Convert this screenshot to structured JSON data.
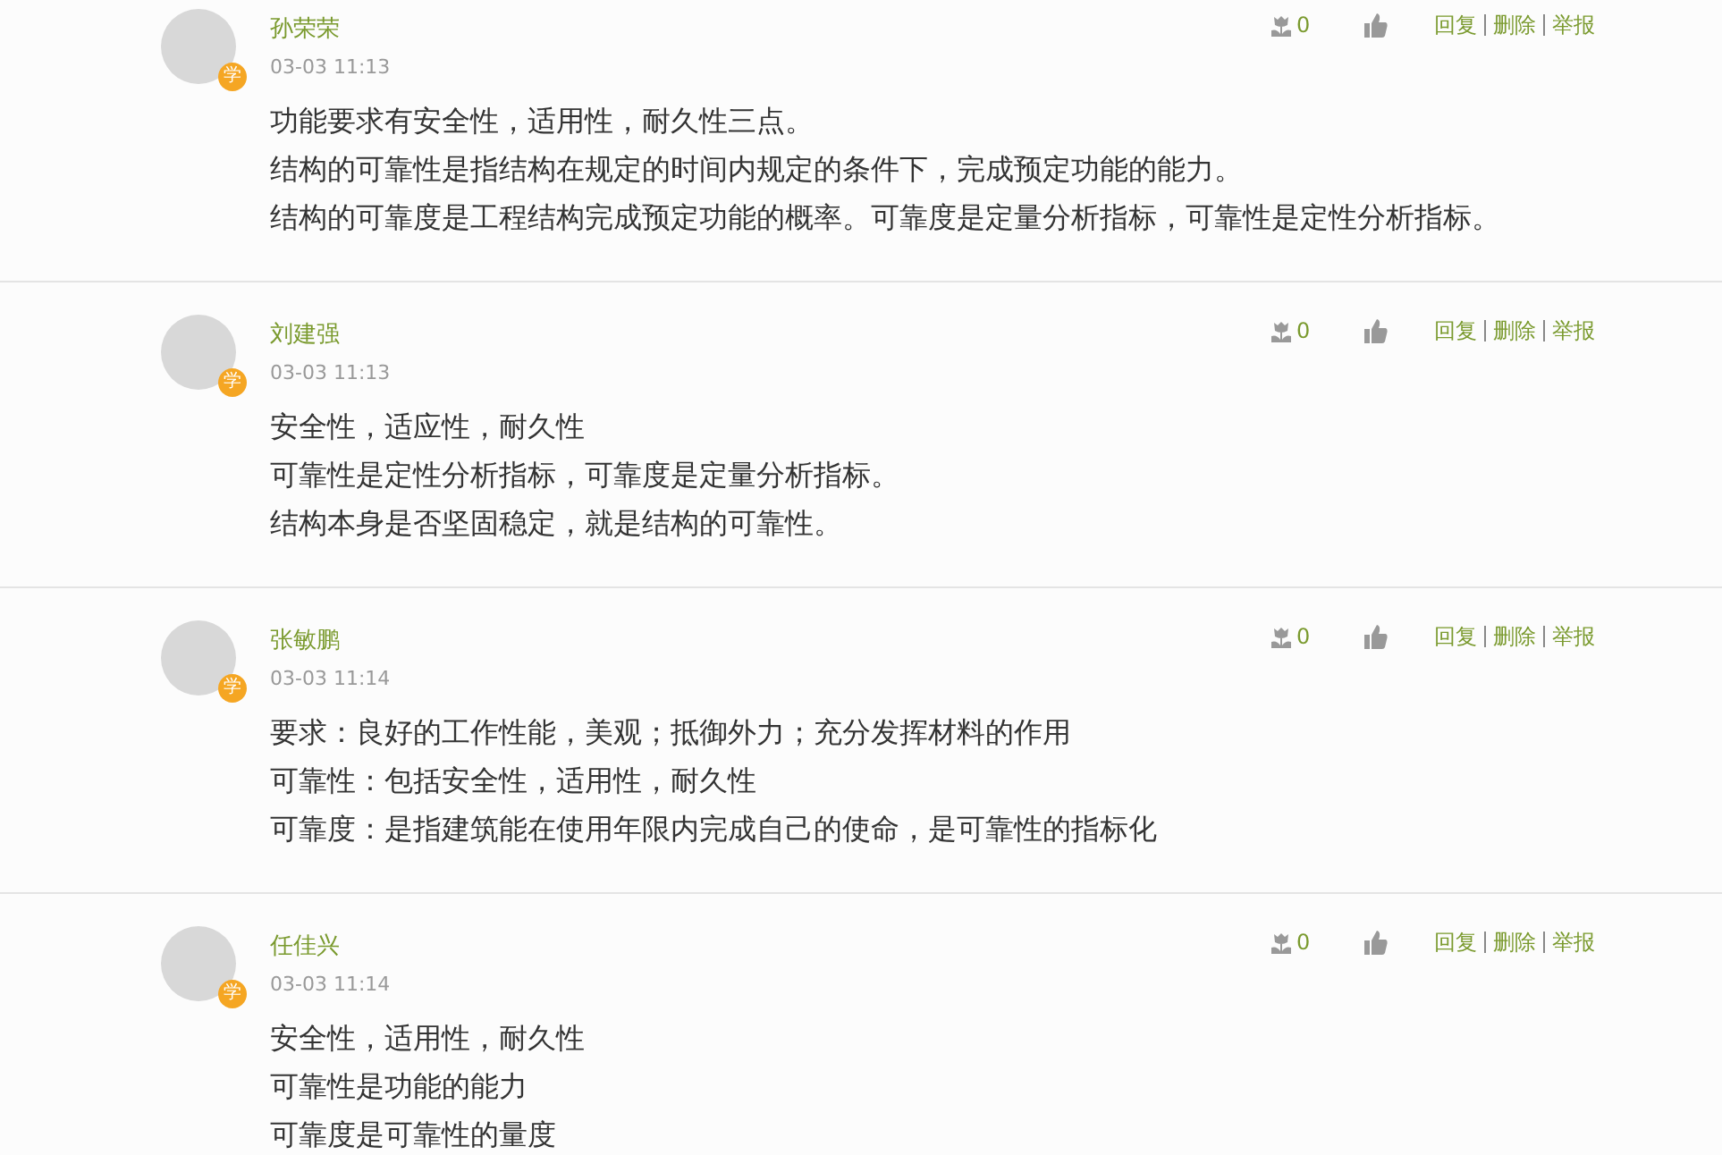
{
  "comments": [
    {
      "name": "孙荣荣",
      "badge": "学",
      "time": "03-03 11:13",
      "flowers": "0",
      "actions": [
        "回复",
        "删除",
        "举报"
      ],
      "lines": [
        "功能要求有安全性，适用性，耐久性三点。",
        "结构的可靠性是指结构在规定的时间内规定的条件下，完成预定功能的能力。",
        "结构的可靠度是工程结构完成预定功能的概率。可靠度是定量分析指标，可靠性是定性分析指标。"
      ]
    },
    {
      "name": "刘建强",
      "badge": "学",
      "time": "03-03 11:13",
      "flowers": "0",
      "actions": [
        "回复",
        "删除",
        "举报"
      ],
      "lines": [
        "安全性，适应性，耐久性",
        "可靠性是定性分析指标，可靠度是定量分析指标。",
        "结构本身是否坚固稳定，就是结构的可靠性。"
      ]
    },
    {
      "name": "张敏鹏",
      "badge": "学",
      "time": "03-03 11:14",
      "flowers": "0",
      "actions": [
        "回复",
        "删除",
        "举报"
      ],
      "lines": [
        "要求：良好的工作性能，美观；抵御外力；充分发挥材料的作用",
        "可靠性：包括安全性，适用性，耐久性",
        "可靠度：是指建筑能在使用年限内完成自己的使命，是可靠性的指标化"
      ]
    },
    {
      "name": "任佳兴",
      "badge": "学",
      "time": "03-03 11:14",
      "flowers": "0",
      "actions": [
        "回复",
        "删除",
        "举报"
      ],
      "lines": [
        "安全性，适用性，耐久性",
        "可靠性是功能的能力",
        "可靠度是可靠性的量度"
      ]
    }
  ]
}
